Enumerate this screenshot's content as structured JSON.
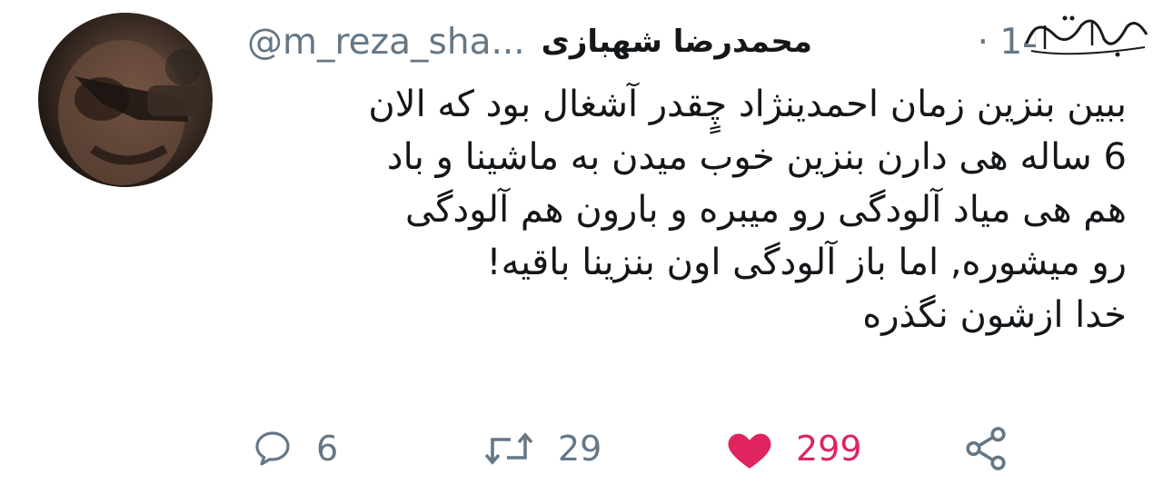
{
  "tweet": {
    "author_name": "محمدرضا شهبازی",
    "handle": "@m_reza_sha...",
    "time": "· 14",
    "text_lines": [
      "ببین بنزین زمان احمدینژاد چٍقدر آشغال بود که الان",
      "6 ساله هی دارن بنزین خوب میدن به ماشینا و باد",
      "هم هی میاد آلودگی رو میبره و بارون هم آلودگی",
      "رو میشوره, اما باز آلودگی اون بنزینا باقیه!",
      "خدا ازشون نگذره"
    ]
  },
  "actions": {
    "reply_count": "6",
    "retweet_count": "29",
    "like_count": "299"
  },
  "watermark": {
    "text": "شهدای ایران"
  },
  "colors": {
    "text": "#14171a",
    "secondary": "#657786",
    "like": "#e0245e"
  }
}
